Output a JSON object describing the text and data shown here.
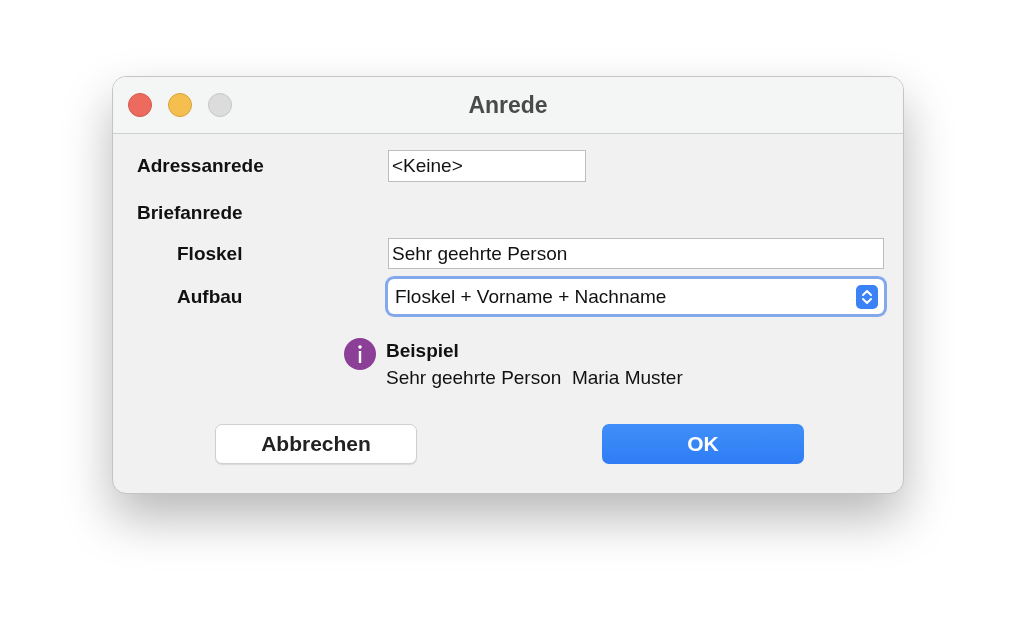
{
  "window": {
    "title": "Anrede"
  },
  "address_salutation": {
    "label": "Adressanrede",
    "value": "<Keine>"
  },
  "letter_salutation": {
    "heading": "Briefanrede",
    "phrase": {
      "label": "Floskel",
      "value": "Sehr geehrte Person"
    },
    "structure": {
      "label": "Aufbau",
      "value": "Floskel + Vorname + Nachname",
      "focused": true
    }
  },
  "example": {
    "title": "Beispiel",
    "text": "Sehr geehrte Person  Maria Muster"
  },
  "buttons": [
    {
      "label": "Abbrechen",
      "default": false
    },
    {
      "label": "OK",
      "default": true
    }
  ]
}
